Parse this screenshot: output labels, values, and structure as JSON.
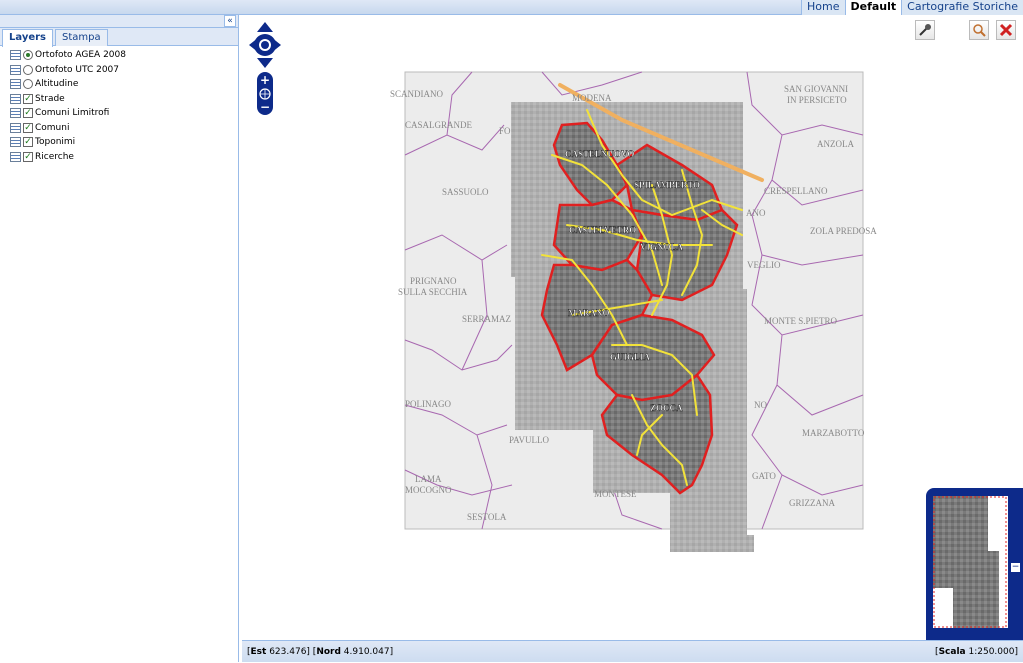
{
  "top_tabs": [
    {
      "label": "Home",
      "active": false
    },
    {
      "label": "Default",
      "active": true
    },
    {
      "label": "Cartografie Storiche",
      "active": false
    }
  ],
  "left_panel": {
    "collapse_icon": "«",
    "tabs": [
      {
        "label": "Layers",
        "active": true
      },
      {
        "label": "Stampa",
        "active": false
      }
    ],
    "layers": [
      {
        "label": "Ortofoto AGEA 2008",
        "control": "radio",
        "checked": true
      },
      {
        "label": "Ortofoto UTC 2007",
        "control": "radio",
        "checked": false
      },
      {
        "label": "Altitudine",
        "control": "radio",
        "checked": false
      },
      {
        "label": "Strade",
        "control": "checkbox",
        "checked": true
      },
      {
        "label": "Comuni Limitrofi",
        "control": "checkbox",
        "checked": true
      },
      {
        "label": "Comuni",
        "control": "checkbox",
        "checked": true
      },
      {
        "label": "Toponimi",
        "control": "checkbox",
        "checked": true
      },
      {
        "label": "Ricerche",
        "control": "checkbox",
        "checked": true
      }
    ]
  },
  "map": {
    "outer_places": [
      {
        "name": "SCANDIANO"
      },
      {
        "name": "MODENA"
      },
      {
        "name": "SAN GIOVANNI"
      },
      {
        "name": "IN PERSICETO"
      },
      {
        "name": "CASALGRANDE"
      },
      {
        "name": "FO"
      },
      {
        "name": "ANZOLA"
      },
      {
        "name": "SASSUOLO"
      },
      {
        "name": "CRESPELLANO"
      },
      {
        "name": "ANO"
      },
      {
        "name": "ZOLA PREDOSA"
      },
      {
        "name": "PRIGNANO"
      },
      {
        "name": "SULLA SECCHIA"
      },
      {
        "name": "VEGLIO"
      },
      {
        "name": "SERRAMAZ"
      },
      {
        "name": "MONTE S.PIETRO"
      },
      {
        "name": "POLINAGO"
      },
      {
        "name": "NO"
      },
      {
        "name": "PAVULLO"
      },
      {
        "name": "MARZABOTTO"
      },
      {
        "name": "LAMA"
      },
      {
        "name": "MOCOGNO"
      },
      {
        "name": "GATO"
      },
      {
        "name": "MONTESE"
      },
      {
        "name": "GRIZZANA"
      },
      {
        "name": "SESTOLA"
      }
    ],
    "municipalities": [
      {
        "name": "CASTELNUOVO"
      },
      {
        "name": "SPILAMBERTO"
      },
      {
        "name": "CASTELVETRO"
      },
      {
        "name": "VIGNOLA"
      },
      {
        "name": "MARANO"
      },
      {
        "name": "GUIGLIA"
      },
      {
        "name": "ZOCCA"
      }
    ],
    "colors": {
      "boundary": "#e02020",
      "roads": "#f2e23a",
      "highway": "#f0b060",
      "limits": "#a868b0"
    }
  },
  "statusbar": {
    "est_label": "Est",
    "est_value": "623.476",
    "nord_label": "Nord",
    "nord_value": "4.910.047",
    "scala_label": "Scala",
    "scala_value": "1:250.000"
  }
}
